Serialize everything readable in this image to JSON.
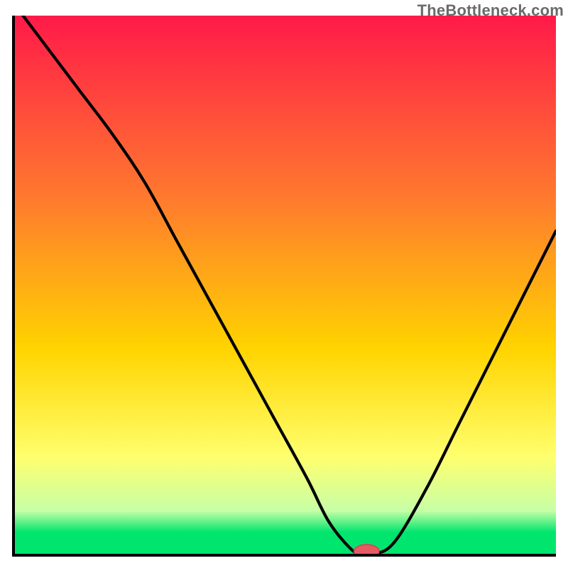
{
  "watermark": "TheBottleneck.com",
  "colors": {
    "gradient_top": "#ff1a49",
    "gradient_mid1": "#ff7a2e",
    "gradient_mid2": "#ffd400",
    "gradient_yellowish": "#ffff6e",
    "gradient_palegreen": "#c7ffa6",
    "gradient_green": "#00e56e",
    "axis": "#000000",
    "curve": "#000000",
    "marker_fill": "#e85a63",
    "marker_stroke": "#d14a55"
  },
  "chart_data": {
    "type": "line",
    "title": "",
    "xlabel": "",
    "ylabel": "",
    "xlim": [
      0,
      100
    ],
    "ylim": [
      0,
      100
    ],
    "x": [
      0,
      6,
      12,
      18,
      24,
      30,
      36,
      42,
      48,
      54,
      58,
      62,
      64,
      66,
      70,
      76,
      82,
      88,
      94,
      100
    ],
    "values": [
      102,
      94,
      86,
      78,
      69,
      58,
      47,
      36,
      25,
      14,
      6,
      1,
      0,
      0,
      2,
      12,
      24,
      36,
      48,
      60
    ],
    "marker": {
      "x": 65,
      "y": 0,
      "rx": 2.3,
      "ry": 1.2
    },
    "notes": "V-shaped bottleneck curve over a vertical red→yellow→green heat gradient. Values read from the plot as percentages of full height; no numeric axis labels are shown."
  }
}
